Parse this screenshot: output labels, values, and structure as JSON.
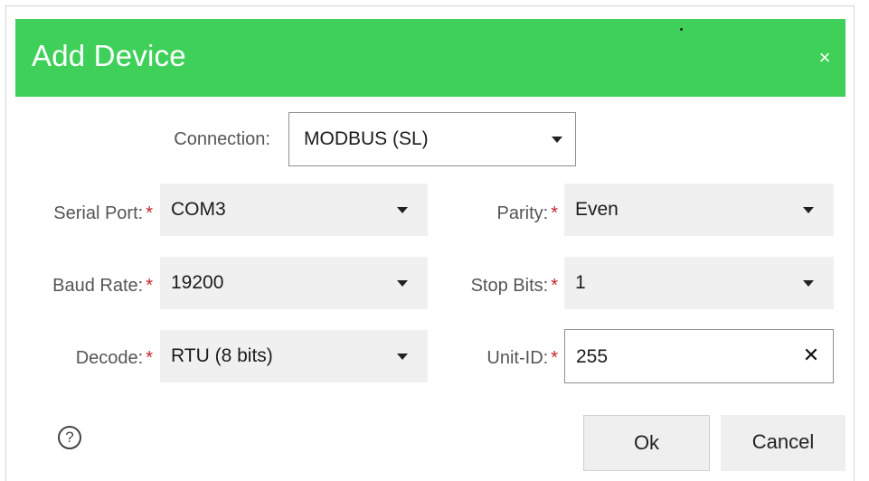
{
  "dialog": {
    "title": "Add Device",
    "close_glyph": "×"
  },
  "connection": {
    "label": "Connection:",
    "value": "MODBUS (SL)"
  },
  "fields": {
    "serial_port": {
      "label": "Serial Port:",
      "value": "COM3"
    },
    "baud_rate": {
      "label": "Baud Rate:",
      "value": "19200"
    },
    "decode": {
      "label": "Decode:",
      "value": "RTU (8 bits)"
    },
    "parity": {
      "label": "Parity:",
      "value": "Even"
    },
    "stop_bits": {
      "label": "Stop Bits:",
      "value": "1"
    },
    "unit_id": {
      "label": "Unit-ID:",
      "value": "255",
      "clear_glyph": "✕"
    }
  },
  "required_marker": "*",
  "help": {
    "glyph": "?"
  },
  "buttons": {
    "ok": "Ok",
    "cancel": "Cancel"
  },
  "colors": {
    "header": "#3fd05a",
    "required": "#c0242f"
  }
}
